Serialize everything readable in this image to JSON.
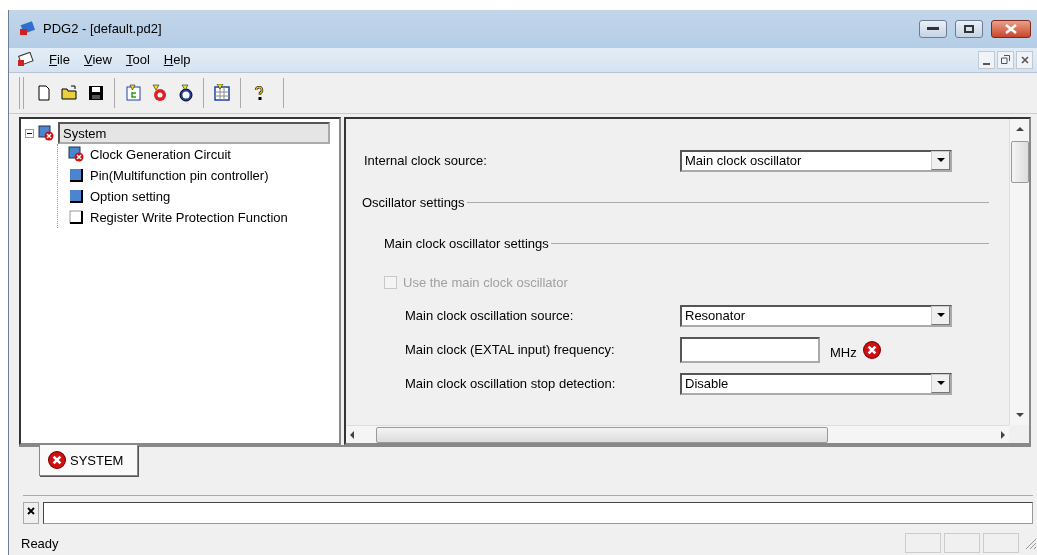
{
  "window": {
    "title": "PDG2 - [default.pd2]"
  },
  "menu": [
    {
      "label": "File"
    },
    {
      "label": "View"
    },
    {
      "label": "Tool"
    },
    {
      "label": "Help"
    }
  ],
  "tree": {
    "label": "System",
    "kind": "error",
    "selected": true,
    "expanded": true,
    "children": [
      {
        "label": "Clock Generation Circuit",
        "kind": "error",
        "selected": false
      },
      {
        "label": "Pin(Multifunction pin controller)",
        "kind": "done",
        "selected": false
      },
      {
        "label": "Option setting",
        "kind": "done",
        "selected": false
      },
      {
        "label": "Register Write Protection Function",
        "kind": "blank",
        "selected": false
      }
    ]
  },
  "form": {
    "rows": [
      {
        "kind": "select",
        "label": "Internal clock source:",
        "value": "Main clock oscillator",
        "indent": false
      },
      {
        "kind": "group",
        "label": "Oscillator settings"
      },
      {
        "kind": "subgroup",
        "label": "Main clock oscillator settings"
      },
      {
        "kind": "checkbox",
        "label": "Use the main clock oscillator",
        "checked": false,
        "disabled": true
      },
      {
        "kind": "select",
        "label": "Main clock oscillation source:",
        "value": "Resonator",
        "indent": true
      },
      {
        "kind": "text",
        "label": "Main clock (EXTAL input) frequency:",
        "unit": "MHz",
        "error": true,
        "indent": true
      },
      {
        "kind": "select",
        "label": "Main clock oscillation stop detection:",
        "value": "Disable",
        "indent": true
      }
    ]
  },
  "tabs": [
    {
      "label": "SYSTEM",
      "selected": true,
      "error": true
    }
  ],
  "status_bar": {
    "text": "Ready"
  }
}
